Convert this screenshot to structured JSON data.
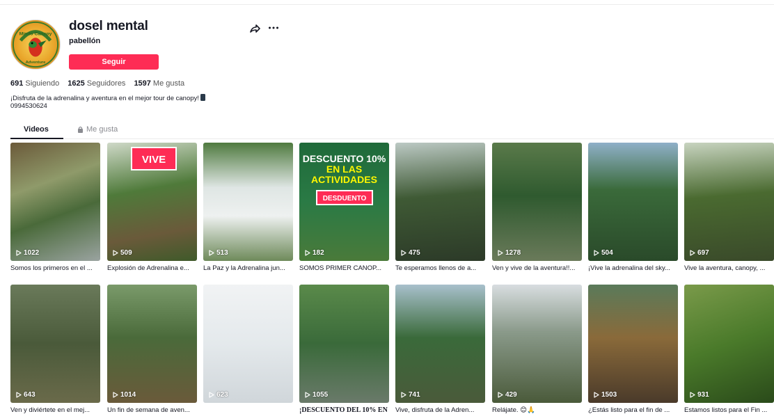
{
  "profile": {
    "username": "dosel mental",
    "nickname": "pabellón",
    "follow_label": "Seguir",
    "avatar_text": "Mindo Canopy Adventure",
    "bio_line1": "¡Disfruta de la adrenalina y aventura en el mejor tour de canopy!",
    "bio_line2": "0994530624"
  },
  "stats": {
    "following_count": "691",
    "following_label": "Siguiendo",
    "followers_count": "1625",
    "followers_label": "Seguidores",
    "likes_count": "1597",
    "likes_label": "Me gusta"
  },
  "tabs": {
    "videos": "Videos",
    "liked": "Me gusta"
  },
  "colors": {
    "accent": "#fe2c55"
  },
  "overlays": {
    "vive": "VIVE",
    "descuento_line1": "DESCUENTO 10%",
    "descuento_line2": "EN LAS ACTIVIDADES",
    "descuento_pill": "DESDUENTO"
  },
  "videos": [
    {
      "views": "1022",
      "caption": "Somos los primeros en el ..."
    },
    {
      "views": "509",
      "caption": "Explosión de Adrenalina e..."
    },
    {
      "views": "513",
      "caption": "La Paz y la Adrenalina jun..."
    },
    {
      "views": "182",
      "caption": "SOMOS PRIMER CANOP..."
    },
    {
      "views": "475",
      "caption": "Te esperamos llenos de a..."
    },
    {
      "views": "1278",
      "caption": "Ven y vive de la aventura!!..."
    },
    {
      "views": "504",
      "caption": "¡Vive la adrenalina del sky..."
    },
    {
      "views": "697",
      "caption": "Vive la aventura, canopy, ..."
    },
    {
      "views": "643",
      "caption": "Ven y diviértete en el mej..."
    },
    {
      "views": "1014",
      "caption": "Un fin de semana de aven..."
    },
    {
      "views": "623",
      "caption": ""
    },
    {
      "views": "1055",
      "caption": "¡DESCUENTO DEL 10% EN"
    },
    {
      "views": "741",
      "caption": "Vive, disfruta de la Adren..."
    },
    {
      "views": "429",
      "caption": "Relájate. 😊🙏"
    },
    {
      "views": "1503",
      "caption": "¿Estás listo para el fin de ..."
    },
    {
      "views": "931",
      "caption": "Estamos listos para el Fin ..."
    }
  ]
}
